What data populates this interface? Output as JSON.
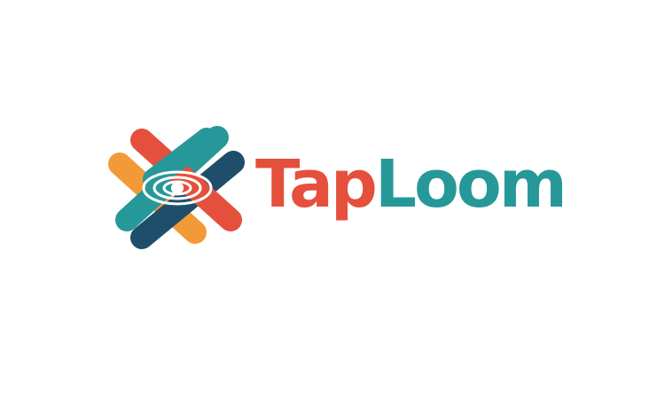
{
  "logo": {
    "icon": "woven-strands-ripple-icon",
    "wordmark_part1": "Tap",
    "wordmark_part2": "Loom"
  },
  "colors": {
    "coral": "#e5503d",
    "teal": "#27989a",
    "orange": "#f29a38",
    "navy": "#1f4e6b",
    "background": "#ffffff"
  }
}
